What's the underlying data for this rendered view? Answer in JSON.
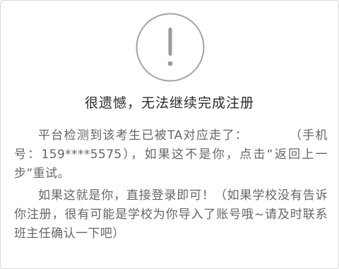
{
  "icon": {
    "name": "warning-exclamation-icon",
    "color": "#9a9a9a"
  },
  "title": "很遗憾，无法继续完成注册",
  "message": {
    "p1_before": "平台检测到该考生已被TA对应走了：",
    "p1_after": "（手机号：159****5575），如果这不是你，点击“返回上一步”重试。",
    "p2": "如果这就是你，直接登录即可！（如果学校没有告诉你注册，很有可能是学校为你导入了账号哦~请及时联系班主任确认一下吧）"
  }
}
